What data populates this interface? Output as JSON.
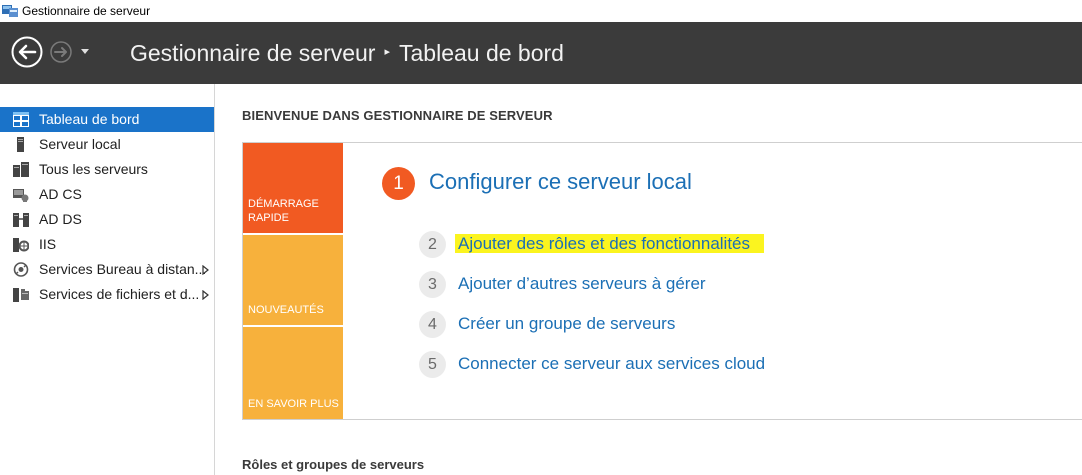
{
  "window": {
    "title": "Gestionnaire de serveur"
  },
  "header": {
    "breadcrumb": [
      "Gestionnaire de serveur",
      "Tableau de bord"
    ],
    "breadcrumb_separator": "▸"
  },
  "sidebar": {
    "items": [
      {
        "label": "Tableau de bord",
        "icon": "dashboard-icon",
        "active": true
      },
      {
        "label": "Serveur local",
        "icon": "server-icon"
      },
      {
        "label": "Tous les serveurs",
        "icon": "servers-icon"
      },
      {
        "label": "AD CS",
        "icon": "adcs-icon"
      },
      {
        "label": "AD DS",
        "icon": "adds-icon"
      },
      {
        "label": "IIS",
        "icon": "iis-icon"
      },
      {
        "label": "Services Bureau à distan...",
        "icon": "remote-desktop-icon",
        "has_submenu": true
      },
      {
        "label": "Services de fichiers et d...",
        "icon": "file-services-icon",
        "has_submenu": true
      }
    ]
  },
  "main": {
    "welcome_title": "BIENVENUE DANS GESTIONNAIRE DE SERVEUR",
    "tiles": [
      {
        "label_line1": "DÉMARRAGE",
        "label_line2": "RAPIDE",
        "color": "#f15a22"
      },
      {
        "label_line1": "NOUVEAUTÉS",
        "color": "#f7b13c"
      },
      {
        "label_line1": "EN SAVOIR PLUS",
        "color": "#f7b13c"
      }
    ],
    "steps": [
      {
        "number": "1",
        "text": "Configurer ce serveur local"
      },
      {
        "number": "2",
        "text": "Ajouter des rôles et des fonctionnalités",
        "highlighted": true
      },
      {
        "number": "3",
        "text": "Ajouter d’autres serveurs à gérer"
      },
      {
        "number": "4",
        "text": "Créer un groupe de serveurs"
      },
      {
        "number": "5",
        "text": "Connecter ce serveur aux services cloud"
      }
    ],
    "roles_title": "Rôles et groupes de serveurs"
  },
  "colors": {
    "header_bg": "#3b3b3b",
    "active_nav": "#1a73c9",
    "accent_orange": "#f15a22",
    "tile_yellow": "#f7b13c",
    "link_blue": "#1b6fb5",
    "highlight": "#fbf41f"
  }
}
